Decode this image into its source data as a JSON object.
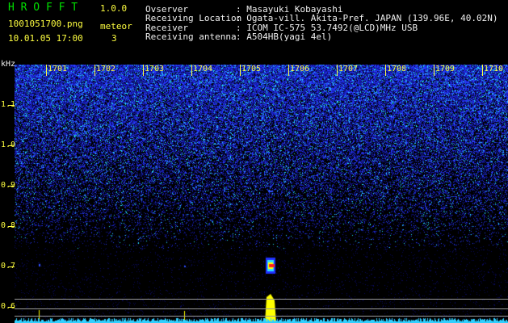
{
  "header": {
    "app_name": "H R O F F T",
    "version": "1.0.0",
    "filename": "1001051700.png",
    "datetime": "10.01.05 17:00",
    "meteor_label": "meteor",
    "meteor_count": "3",
    "observer_label": "Ovserver",
    "observer_value": ": Masayuki Kobayashi",
    "location_label": "Receiving Location",
    "location_value": ": Ogata-vill. Akita-Pref. JAPAN (139.96E, 40.02N)",
    "receiver_label": "Receiver",
    "receiver_value": ": ICOM IC-575 53.7492(@LCD)MHz USB",
    "antenna_label": "Receiving antenna",
    "antenna_value": ": A504HB(yagi 4el)"
  },
  "axis": {
    "unit": "kHz",
    "y_ticks": [
      "1.1",
      "1.0",
      "0.9",
      "0.8",
      "0.7",
      "0.6"
    ],
    "x_ticks": [
      "1701",
      "1702",
      "1703",
      "1704",
      "1705",
      "1706",
      "1707",
      "1708",
      "1709",
      "1710"
    ]
  },
  "colors": {
    "background": "#000000",
    "noise_blue": "#2030ff",
    "noise_cyan": "#30e0ff",
    "meteor_red": "#ff2020",
    "signal_yellow": "#ffff00",
    "label_yellow": "#ffff40",
    "title_green": "#00e000"
  }
}
